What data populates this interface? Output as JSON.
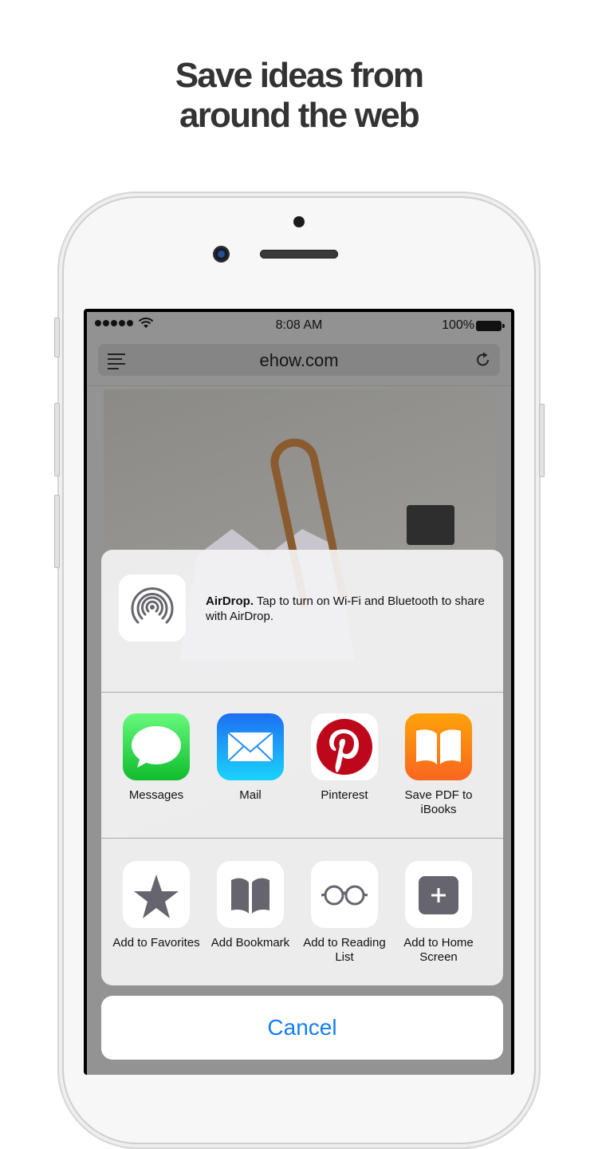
{
  "headline": {
    "line1": "Save ideas from",
    "line2": "around the web"
  },
  "statusbar": {
    "time": "8:08 AM",
    "battery": "100%",
    "signal_bars": 5
  },
  "browser": {
    "url": "ehow.com",
    "menu_icon": "reader-menu-icon",
    "reload_icon": "reload-icon"
  },
  "share_sheet": {
    "airdrop": {
      "title": "AirDrop.",
      "message": "Tap to turn on Wi-Fi and Bluetooth to share with AirDrop."
    },
    "apps": [
      {
        "label": "Messages",
        "icon": "messages-icon",
        "color": "#2fcb4b"
      },
      {
        "label": "Mail",
        "icon": "mail-icon",
        "color": "#1e8ff5"
      },
      {
        "label": "Pinterest",
        "icon": "pinterest-icon",
        "color": "#bd081c"
      },
      {
        "label": "Save PDF to iBooks",
        "icon": "ibooks-icon",
        "color": "#fb8b1e"
      }
    ],
    "actions": [
      {
        "label": "Add to Favorites",
        "icon": "star-icon"
      },
      {
        "label": "Add Bookmark",
        "icon": "book-icon"
      },
      {
        "label": "Add to Reading List",
        "icon": "glasses-icon"
      },
      {
        "label": "Add to Home Screen",
        "icon": "plus-square-icon"
      }
    ],
    "cancel_label": "Cancel"
  },
  "colors": {
    "accent": "#157efb",
    "headline": "#333333",
    "action_icon": "#66656d"
  }
}
